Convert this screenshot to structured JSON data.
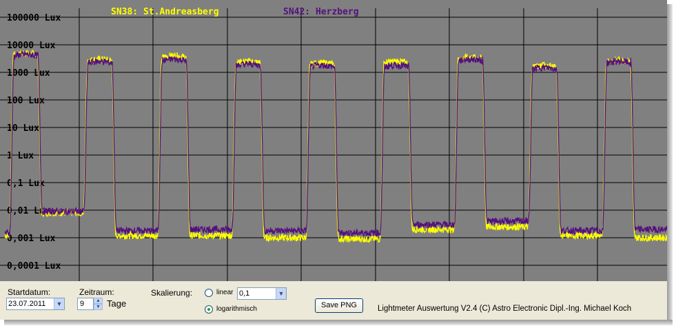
{
  "chart_data": {
    "type": "line",
    "y_scale": "log",
    "ylim_lux": [
      5e-05,
      100000
    ],
    "x_days": 9,
    "grid": true,
    "y_tick_labels": [
      "100000 Lux",
      "10000 Lux",
      "1000 Lux",
      "100 Lux",
      "10 Lux",
      "1 Lux",
      "0,1 Lux",
      "0,01 Lux",
      "0,001 Lux",
      "0,0001 Lux"
    ],
    "series": [
      {
        "name": "SN38: St.Andreasberg",
        "color": "#ffff00",
        "day_lux": [
          5000,
          3000,
          4000,
          2500,
          2200,
          2500,
          3500,
          1800,
          2800
        ],
        "night_lux": [
          0.0012,
          0.008,
          0.0012,
          0.0012,
          0.001,
          0.0009,
          0.002,
          0.0025,
          0.0012,
          0.001
        ]
      },
      {
        "name": "SN42: Herzberg",
        "color": "#55107d",
        "day_lux": [
          4500,
          2500,
          3000,
          2000,
          1800,
          1800,
          3000,
          1500,
          2500
        ],
        "night_lux": [
          0.0015,
          0.009,
          0.0018,
          0.002,
          0.0018,
          0.0015,
          0.003,
          0.004,
          0.0018,
          0.002
        ]
      }
    ]
  },
  "legend": {
    "series1": "SN38: St.Andreasberg",
    "series2": "SN42: Herzberg"
  },
  "controls": {
    "startdatum_label": "Startdatum:",
    "startdatum_value": "23.07.2011",
    "zeitraum_label": "Zeitraum:",
    "zeitraum_value": "9",
    "zeitraum_unit": "Tage",
    "skalierung_label": "Skalierung:",
    "linear_label": "linear",
    "linear_value": "0,1",
    "log_label": "logarithmisch",
    "scale_selected": "logarithmisch",
    "save_label": "Save PNG",
    "footer": "Lightmeter Auswertung V2.4  (C) Astro Electronic Dipl.-Ing. Michael Koch"
  },
  "icons": {
    "dropdown": "chevron-down-icon",
    "spin_up": "arrow-up-icon",
    "spin_down": "arrow-down-icon"
  }
}
